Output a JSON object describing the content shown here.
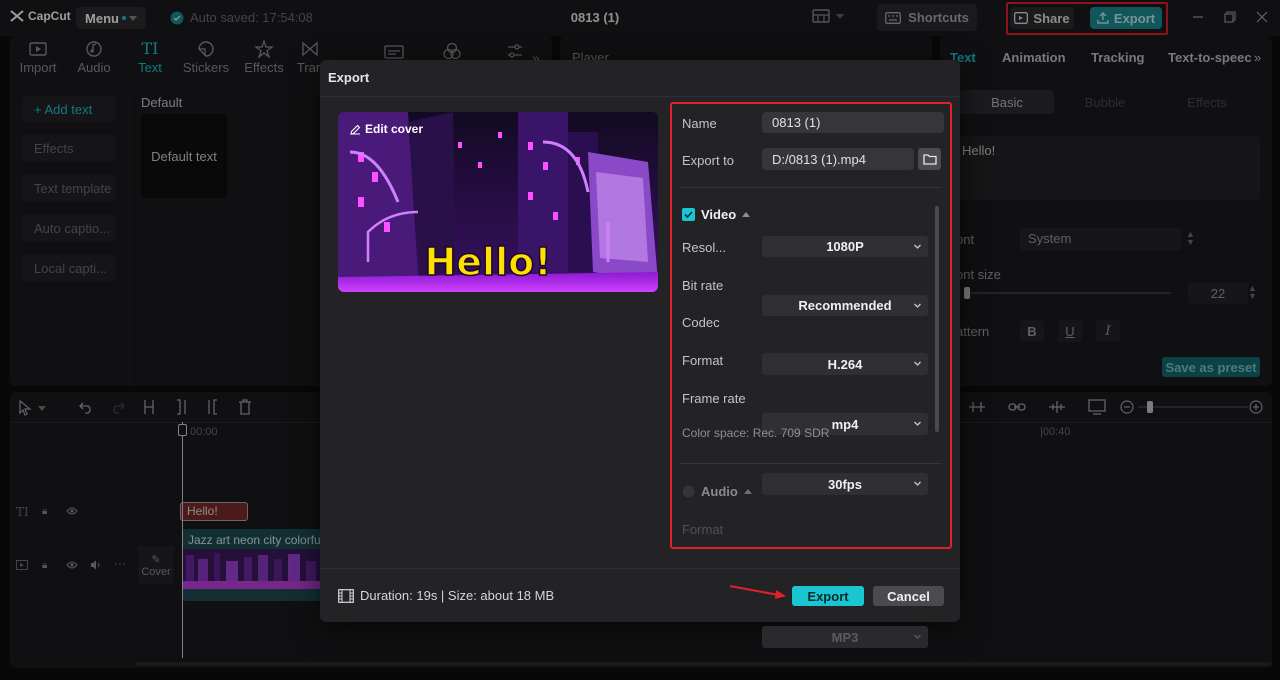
{
  "app": {
    "logo_text": "CapCut",
    "menu_label": "Menu",
    "autosave_text": "Auto saved: 17:54:08",
    "project_title": "0813 (1)",
    "shortcuts_label": "Shortcuts",
    "share_label": "Share",
    "export_label": "Export"
  },
  "toolbar": {
    "items": [
      {
        "label": "Import",
        "icon": "import-icon"
      },
      {
        "label": "Audio",
        "icon": "audio-icon"
      },
      {
        "label": "Text",
        "icon": "text-icon"
      },
      {
        "label": "Stickers",
        "icon": "stickers-icon"
      },
      {
        "label": "Effects",
        "icon": "effects-icon"
      },
      {
        "label": "Tran",
        "icon": "transitions-icon"
      }
    ]
  },
  "sidebar": {
    "items": [
      {
        "label": "+ Add text"
      },
      {
        "label": "Effects"
      },
      {
        "label": "Text template"
      },
      {
        "label": "Auto captio..."
      },
      {
        "label": "Local capti..."
      }
    ]
  },
  "library": {
    "heading": "Default",
    "card_label": "Default text"
  },
  "player": {
    "label": "Player"
  },
  "right_panel": {
    "tabs": [
      "Text",
      "Animation",
      "Tracking",
      "Text-to-speec"
    ],
    "subtabs": [
      "Basic",
      "Bubble",
      "Effects"
    ],
    "text_value": "Hello!",
    "font_label": "ont",
    "font_value": "System",
    "font_size_label": "ont size",
    "font_size_value": "22",
    "pattern_label": "attern",
    "save_preset_label": "Save as preset"
  },
  "timeline": {
    "time_start": "00:00",
    "time_end": "|00:40",
    "text_clip_label": "Hello!",
    "video_clip_label": "Jazz art neon city colorfu",
    "cover_label": "Cover"
  },
  "modal": {
    "title": "Export",
    "edit_cover_label": "Edit cover",
    "cover_text": "Hello!",
    "name_label": "Name",
    "name_value": "0813 (1)",
    "export_to_label": "Export to",
    "export_to_value": "D:/0813 (1).mp4",
    "video_section": "Video",
    "video_checked": true,
    "resolution_label": "Resol...",
    "resolution_value": "1080P",
    "bitrate_label": "Bit rate",
    "bitrate_value": "Recommended",
    "codec_label": "Codec",
    "codec_value": "H.264",
    "format_label": "Format",
    "format_value": "mp4",
    "framerate_label": "Frame rate",
    "framerate_value": "30fps",
    "color_space": "Color space: Rec. 709 SDR",
    "audio_section": "Audio",
    "audio_format_label": "Format",
    "audio_format_value": "MP3",
    "duration_text": "Duration: 19s | Size: about 18 MB",
    "export_button": "Export",
    "cancel_button": "Cancel"
  },
  "colors": {
    "accent": "#19c6d1",
    "highlight": "#e0202a",
    "background": "#0e0e10",
    "panel": "#1b1b1e",
    "modal": "#232326"
  }
}
